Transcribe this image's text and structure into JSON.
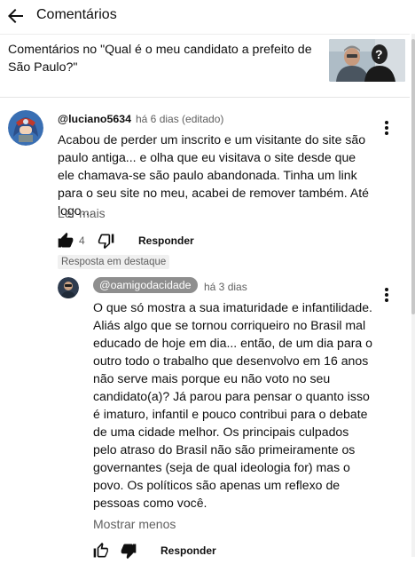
{
  "header": {
    "title": "Comentários"
  },
  "video": {
    "title": "Comentários no \"Qual é o meu candidato a prefeito de São Paulo?\""
  },
  "comment": {
    "author": "@luciano5634",
    "meta": "há 6 dias (editado)",
    "text": "Acabou de perder um inscrito e um visitante do site são paulo antiga... e olha que eu visitava o site desde que ele chamava-se são paulo abandonada. Tinha um link para o seu site no meu, acabei de remover também. Até logo…",
    "read_more": "Ler mais",
    "likes": "4",
    "reply_label": "Responder",
    "featured_badge": "Resposta em destaque"
  },
  "reply": {
    "author": "@oamigodacidade",
    "meta": "há 3 dias",
    "text": "O que só mostra a sua imaturidade e infantilidade. Aliás algo que se tornou corriqueiro no Brasil mal educado de hoje em dia... então, de um dia para o outro todo o trabalho que desenvolvo em 16 anos não serve mais porque eu não voto no seu candidato(a)? Já parou para pensar o quanto isso é imaturo, infantil e pouco contribui para o debate de uma cidade melhor. Os principais culpados pelo atraso do Brasil não são primeiramente os governantes (seja de qual ideologia for) mas o povo. Os políticos são apenas um reflexo de pessoas como você.",
    "show_less": "Mostrar menos",
    "reply_label": "Responder"
  }
}
